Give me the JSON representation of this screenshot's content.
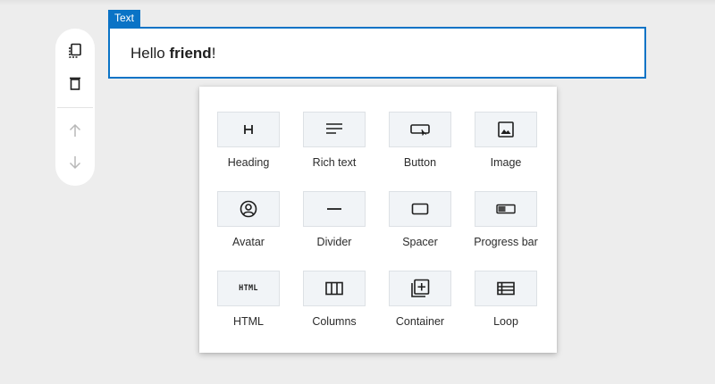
{
  "block": {
    "tag_label": "Text",
    "text_before": "Hello ",
    "text_bold": "friend",
    "text_after": "!"
  },
  "toolbar": {
    "icons": [
      "duplicate-icon",
      "trash-icon",
      "arrow-up-icon",
      "arrow-down-icon"
    ]
  },
  "inserter": {
    "items": [
      {
        "label": "Heading",
        "icon": "heading-icon"
      },
      {
        "label": "Rich text",
        "icon": "rich-text-icon"
      },
      {
        "label": "Button",
        "icon": "button-icon"
      },
      {
        "label": "Image",
        "icon": "image-icon"
      },
      {
        "label": "Avatar",
        "icon": "avatar-icon"
      },
      {
        "label": "Divider",
        "icon": "divider-icon"
      },
      {
        "label": "Spacer",
        "icon": "spacer-icon"
      },
      {
        "label": "Progress bar",
        "icon": "progress-bar-icon"
      },
      {
        "label": "HTML",
        "icon": "html-icon",
        "glyph": "HTML"
      },
      {
        "label": "Columns",
        "icon": "columns-icon"
      },
      {
        "label": "Container",
        "icon": "container-icon"
      },
      {
        "label": "Loop",
        "icon": "loop-icon"
      }
    ]
  },
  "colors": {
    "accent": "#0a73c6",
    "tile_bg": "#f1f4f7",
    "canvas": "#ededed"
  }
}
